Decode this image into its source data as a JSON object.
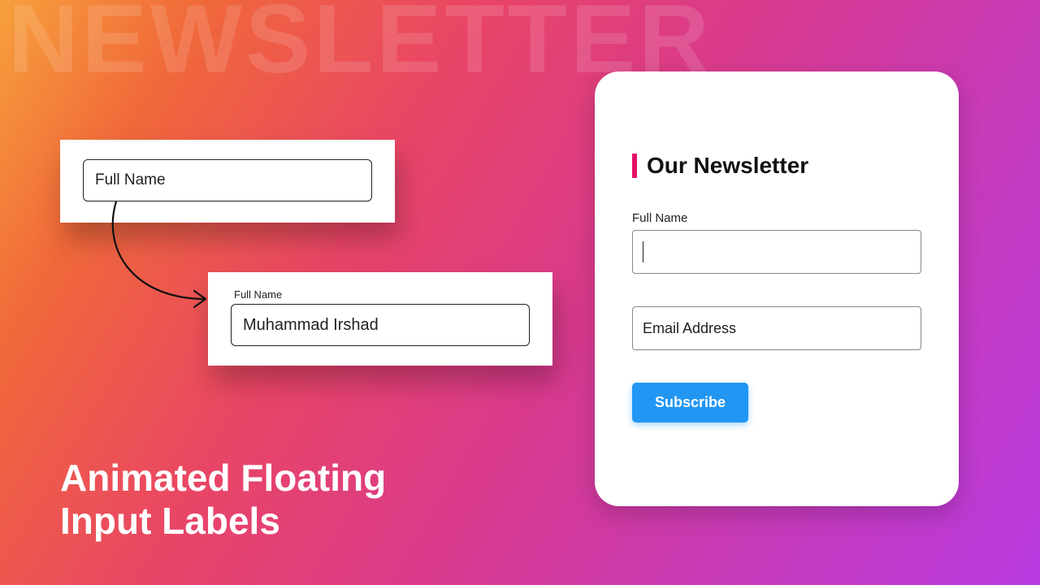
{
  "background": {
    "watermark": "NEWSLETTER"
  },
  "headline": {
    "line1": "Animated Floating",
    "line2": "Input Labels"
  },
  "demo1": {
    "placeholder": "Full Name"
  },
  "demo2": {
    "label": "Full Name",
    "value": "Muhammad Irshad"
  },
  "card": {
    "title": "Our Newsletter",
    "fields": {
      "name_label": "Full Name",
      "name_value": "",
      "email_label": "Email Address",
      "email_value": ""
    },
    "button": "Subscribe"
  },
  "colors": {
    "accent": "#e6106a",
    "button": "#2196f3"
  }
}
